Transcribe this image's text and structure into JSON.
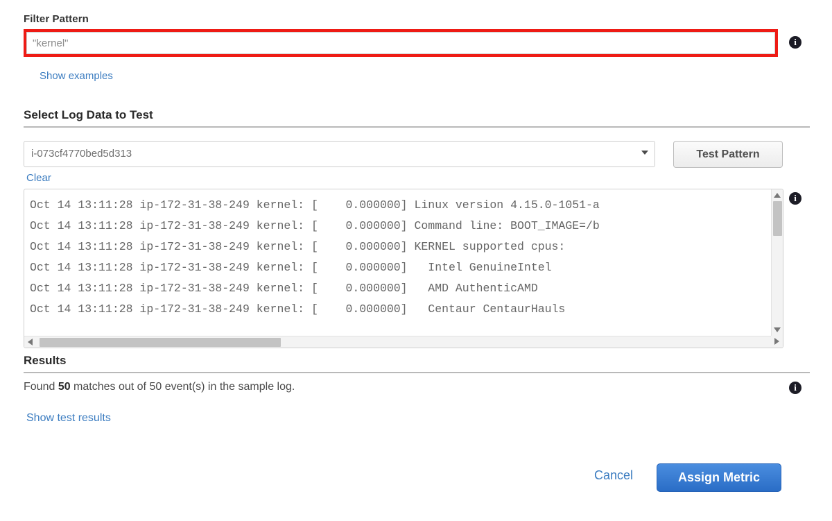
{
  "filter_pattern": {
    "label": "Filter Pattern",
    "value": "\"kernel\"",
    "placeholder": "\"kernel\"",
    "info_icon": "info-icon",
    "show_examples_label": "Show examples",
    "highlight_color": "#ee1b15"
  },
  "select_log_data": {
    "heading": "Select Log Data to Test",
    "selected_value": "i-073cf4770bed5d313",
    "caret_icon": "chevron-down-icon",
    "test_button_label": "Test Pattern",
    "clear_label": "Clear",
    "info_icon": "info-icon"
  },
  "log_sample": {
    "lines": [
      "Oct 14 13:11:28 ip-172-31-38-249 kernel: [    0.000000] Linux version 4.15.0-1051-a",
      "Oct 14 13:11:28 ip-172-31-38-249 kernel: [    0.000000] Command line: BOOT_IMAGE=/b",
      "Oct 14 13:11:28 ip-172-31-38-249 kernel: [    0.000000] KERNEL supported cpus:",
      "Oct 14 13:11:28 ip-172-31-38-249 kernel: [    0.000000]   Intel GenuineIntel",
      "Oct 14 13:11:28 ip-172-31-38-249 kernel: [    0.000000]   AMD AuthenticAMD",
      "Oct 14 13:11:28 ip-172-31-38-249 kernel: [    0.000000]   Centaur CentaurHauls"
    ],
    "scroll_up_icon": "triangle-up-icon",
    "scroll_down_icon": "triangle-down-icon",
    "scroll_left_icon": "triangle-left-icon",
    "scroll_right_icon": "triangle-right-icon"
  },
  "results": {
    "heading": "Results",
    "text_prefix": "Found ",
    "match_count": "50",
    "text_suffix": " matches out of 50 event(s) in the sample log.",
    "show_test_results_label": "Show test results",
    "info_icon": "info-icon"
  },
  "footer": {
    "cancel_label": "Cancel",
    "assign_metric_label": "Assign Metric",
    "primary_color": "#2a6dc6",
    "link_color": "#3b7cc0"
  }
}
